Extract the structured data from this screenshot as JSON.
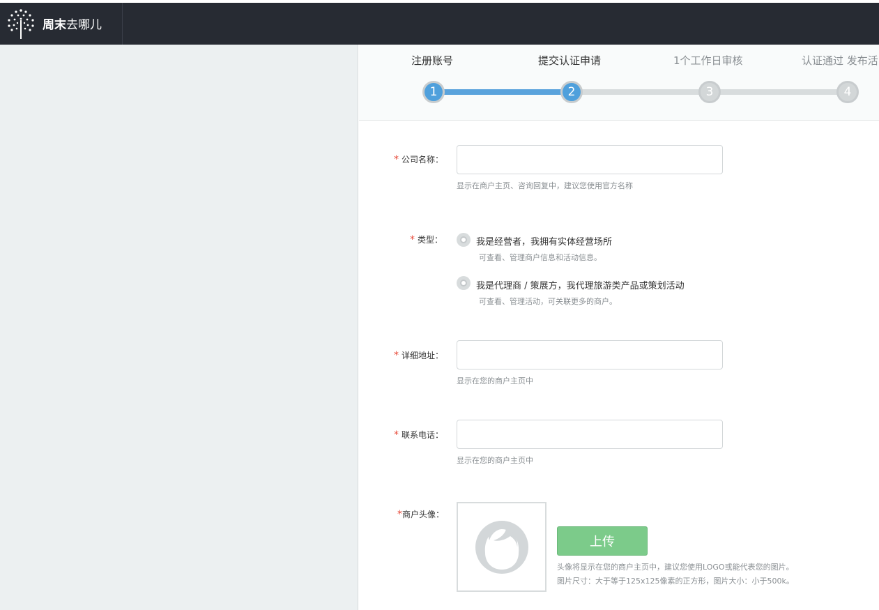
{
  "header": {
    "brand_bold": "周末",
    "brand_light": "去哪儿"
  },
  "steps": [
    {
      "label": "注册账号",
      "number": "1",
      "state": "done"
    },
    {
      "label": "提交认证申请",
      "number": "2",
      "state": "done"
    },
    {
      "label": "1个工作日审核",
      "number": "3",
      "state": "todo"
    },
    {
      "label": "认证通过 发布活",
      "number": "4",
      "state": "todo"
    }
  ],
  "form": {
    "required_mark": "*",
    "company_name": {
      "label": "公司名称：",
      "value": "",
      "hint": "显示在商户主页、咨询回复中，建议您使用官方名称"
    },
    "type": {
      "label": "类型：",
      "options": [
        {
          "label": "我是经营者，我拥有实体经营场所",
          "hint": "可查看、管理商户信息和活动信息。"
        },
        {
          "label": "我是代理商 / 策展方，我代理旅游类产品或策划活动",
          "hint": "可查看、管理活动，可关联更多的商户。"
        }
      ]
    },
    "address": {
      "label": "详细地址：",
      "value": "",
      "hint": "显示在您的商户主页中"
    },
    "phone": {
      "label": "联系电话：",
      "value": "",
      "hint": "显示在您的商户主页中"
    },
    "avatar": {
      "label": "商户头像：",
      "upload_label": "上传",
      "hint_line1": "头像将显示在您的商户主页中，建议您使用LOGO或能代表您的图片。",
      "hint_line2": "图片尺寸：大于等于125x125像素的正方形，图片大小：小于500k。"
    }
  },
  "colors": {
    "header_bg": "#272b33",
    "step_active": "#4fa0dc",
    "upload_button": "#7ccb8a",
    "required": "#e74c3c"
  }
}
